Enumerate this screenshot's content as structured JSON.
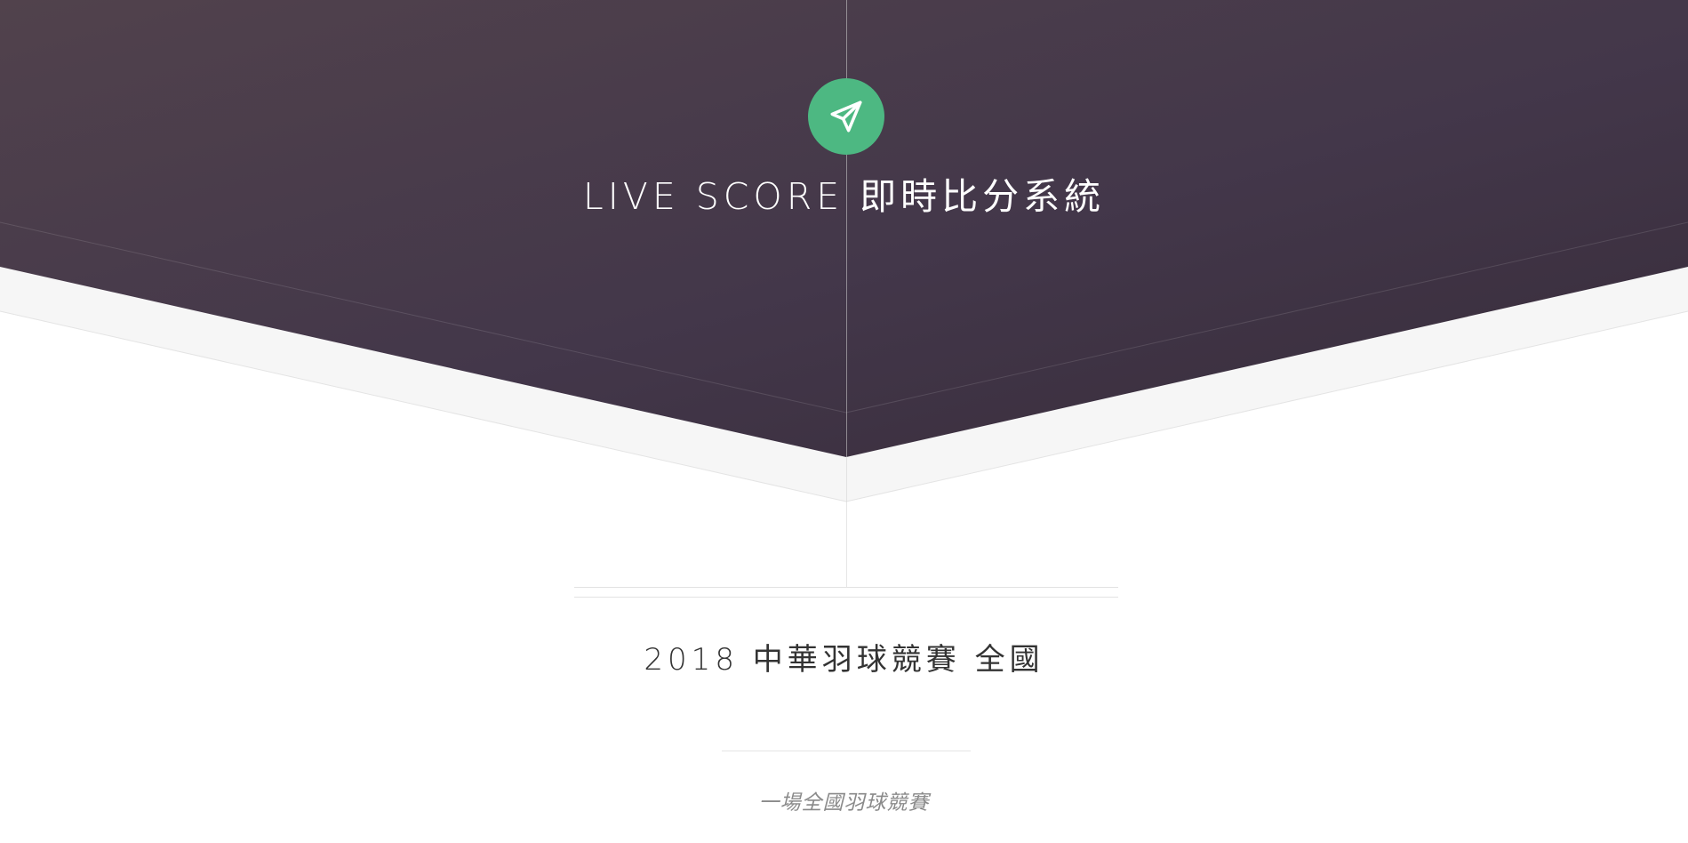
{
  "header": {
    "logo_icon": "paper-plane-icon",
    "title": "LIVE SCORE 即時比分系統",
    "accent_color": "#4db882",
    "hero_color": "#463a47"
  },
  "event": {
    "title": "2018 中華羽球競賽 全國",
    "tagline": "一場全國羽球競賽"
  }
}
